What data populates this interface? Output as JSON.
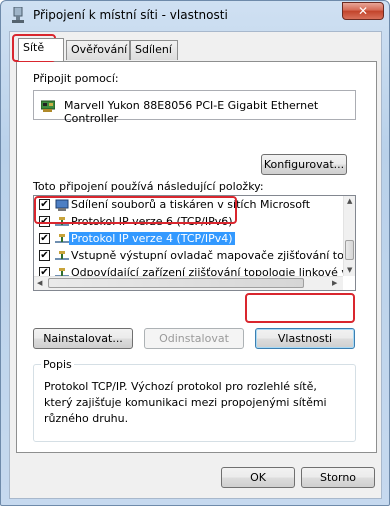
{
  "window": {
    "title": "Připojení k místní síti - vlastnosti",
    "close_label": "✕"
  },
  "tabs": [
    {
      "label": "Sítě",
      "active": true
    },
    {
      "label": "Ověřování",
      "active": false
    },
    {
      "label": "Sdílení",
      "active": false
    }
  ],
  "connect_using": {
    "label": "Připojit pomocí:",
    "adapter_name": "Marvell Yukon 88E8056 PCI-E Gigabit Ethernet Controller",
    "configure_label": "Konfigurovat..."
  },
  "items": {
    "label": "Toto připojení používá následující položky:",
    "list": [
      {
        "label": "Sdílení souborů a tiskáren v sítích Microsoft",
        "checked": true,
        "icon": "file-printer-sharing-icon",
        "selected": false
      },
      {
        "label": "Protokol IP verze 6 (TCP/IPv6)",
        "checked": true,
        "icon": "network-protocol-icon",
        "selected": false
      },
      {
        "label": "Protokol IP verze 4 (TCP/IPv4)",
        "checked": true,
        "icon": "network-protocol-icon",
        "selected": true
      },
      {
        "label": "Vstupně výstupní ovladač mapovače zjišťování topolo",
        "checked": true,
        "icon": "network-protocol-icon",
        "selected": false
      },
      {
        "label": "Odpovídající zařízení zjišťování topologie linkové vrst",
        "checked": true,
        "icon": "network-protocol-icon",
        "selected": false
      }
    ]
  },
  "buttons": {
    "install": "Nainstalovat...",
    "uninstall": "Odinstalovat",
    "properties": "Vlastnosti",
    "ok": "OK",
    "cancel": "Storno"
  },
  "description": {
    "title": "Popis",
    "text": "Protokol TCP/IP. Výchozí protokol pro rozlehlé sítě, který zajišťuje komunikaci mezi propojenými sítěmi různého druhu."
  },
  "highlight_color": "#d9262e",
  "selection_color": "#3399ff"
}
